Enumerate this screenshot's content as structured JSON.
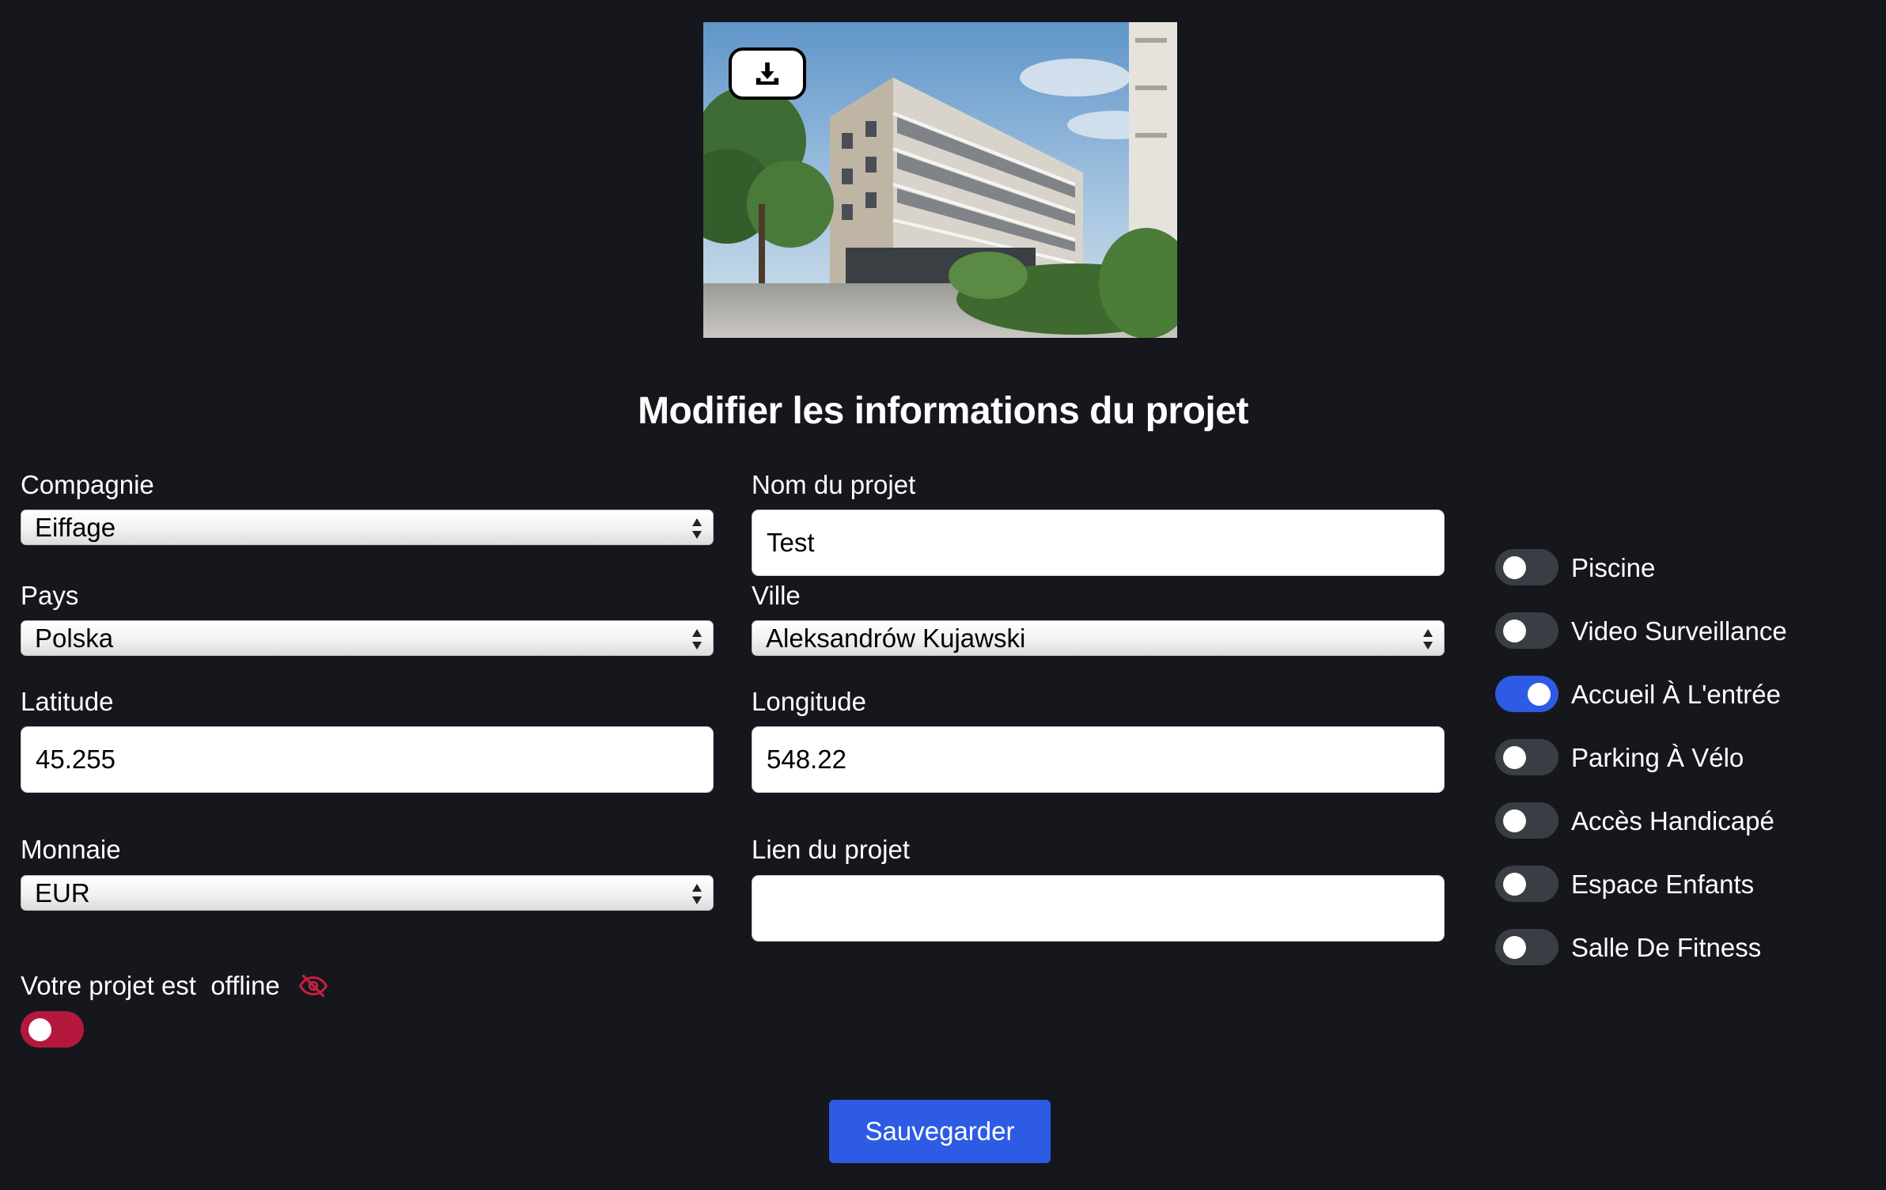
{
  "form": {
    "title": "Modifier les informations du projet",
    "company": {
      "label": "Compagnie",
      "value": "Eiffage"
    },
    "country": {
      "label": "Pays",
      "value": "Polska"
    },
    "latitude": {
      "label": "Latitude",
      "value": "45.255"
    },
    "currency": {
      "label": "Monnaie",
      "value": "EUR"
    },
    "project_name": {
      "label": "Nom du projet",
      "value": "Test"
    },
    "city": {
      "label": "Ville",
      "value": "Aleksandrów Kujawski"
    },
    "longitude": {
      "label": "Longitude",
      "value": "548.22"
    },
    "project_link": {
      "label": "Lien du projet",
      "value": ""
    },
    "offline": {
      "label_prefix": "Votre projet est",
      "status": "offline",
      "enabled": false
    },
    "save_label": "Sauvegarder"
  },
  "amenities": [
    {
      "label": "Piscine",
      "enabled": false
    },
    {
      "label": "Video Surveillance",
      "enabled": false
    },
    {
      "label": "Accueil À L'entrée",
      "enabled": true
    },
    {
      "label": "Parking À Vélo",
      "enabled": false
    },
    {
      "label": "Accès Handicapé",
      "enabled": false
    },
    {
      "label": "Espace Enfants",
      "enabled": false
    },
    {
      "label": "Salle De Fitness",
      "enabled": false
    }
  ],
  "icons": {
    "upload": "download-tray-icon",
    "visibility": "eye-slash-icon",
    "select_arrows": "sort-arrows-icon"
  },
  "colors": {
    "background": "#16171d",
    "accent": "#2d5be3",
    "danger": "#b5183d",
    "toggle_off": "#3b3d44"
  }
}
